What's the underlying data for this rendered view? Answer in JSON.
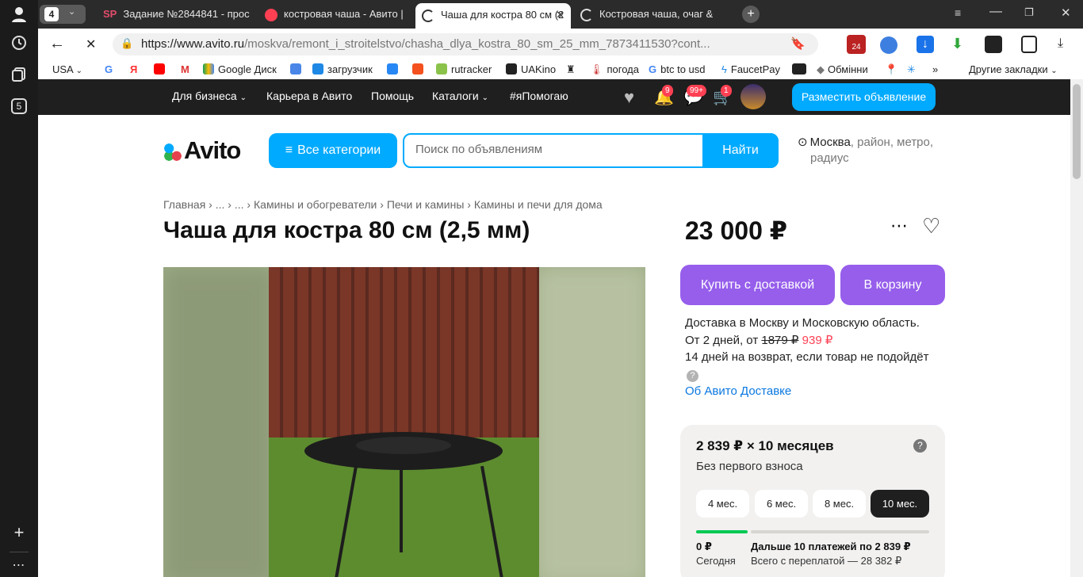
{
  "browser": {
    "tab_count": "4",
    "tabs": [
      {
        "title": "Задание №2844841 - прос",
        "icon_text": "SP"
      },
      {
        "title": "костровая чаша - Авито |"
      },
      {
        "title": "Чаша для костра 80 см (2"
      },
      {
        "title": "Костровая чаша, очаг &"
      }
    ],
    "url_main": "https://www.avito.ru",
    "url_rest": "/moskva/remont_i_stroitelstvo/chasha_dlya_kostra_80_sm_25_mm_7873411530?cont...",
    "ext_badge": "24",
    "sidebar_badge": "5",
    "bookmarks": [
      "USA",
      "Google Диск",
      "загрузчик",
      "rutracker",
      "UAKino",
      "погода",
      "btc to usd",
      "FaucetPay",
      "Обмінни"
    ],
    "bookmarks_more": "»",
    "bookmarks_other": "Другие закладки"
  },
  "nav": {
    "items": [
      "Для бизнеса",
      "Карьера в Авито",
      "Помощь",
      "Каталоги",
      "#яПомогаю"
    ],
    "notif_badge": "9",
    "msg_badge": "99+",
    "cart_badge": "1",
    "place_ad": "Разместить объявление"
  },
  "header": {
    "logo": "Avito",
    "all_categories": "Все категории",
    "search_placeholder": "Поиск по объявлениям",
    "find": "Найти",
    "location_city": "Москва",
    "location_rest": ", район, метро,",
    "location_rest2": "радиус"
  },
  "breadcrumbs": [
    "Главная",
    "...",
    "...",
    "Камины и обогреватели",
    "Печи и камины",
    "Камины и печи для дома"
  ],
  "listing": {
    "title": "Чаша для костра 80 см (2,5 мм)",
    "price": "23 000 ₽",
    "buy_delivery": "Купить с доставкой",
    "to_cart": "В корзину",
    "delivery_line1": "Доставка в Москву и Московскую область.",
    "delivery_from": "От 2 дней, от",
    "delivery_old_price": "1879 ₽",
    "delivery_new_price": "939 ₽",
    "return_line": "14 дней на возврат, если товар не подойдёт",
    "about_delivery": "Об Авито Доставке"
  },
  "credit": {
    "monthly": "2 839 ₽ × 10 месяцев",
    "no_downpayment": "Без первого взноса",
    "terms": [
      "4 мес.",
      "6 мес.",
      "8 мес.",
      "10 мес."
    ],
    "selected_term_index": 3,
    "today_amount": "0 ₽",
    "today_label": "Сегодня",
    "next_payments": "Дальше 10 платежей по 2 839 ₽",
    "total": "Всего с переплатой — 28 382 ₽"
  },
  "colors": {
    "accent": "#00aaff",
    "violet": "#965eeb",
    "badge": "#ff4053",
    "green": "#00c853"
  }
}
